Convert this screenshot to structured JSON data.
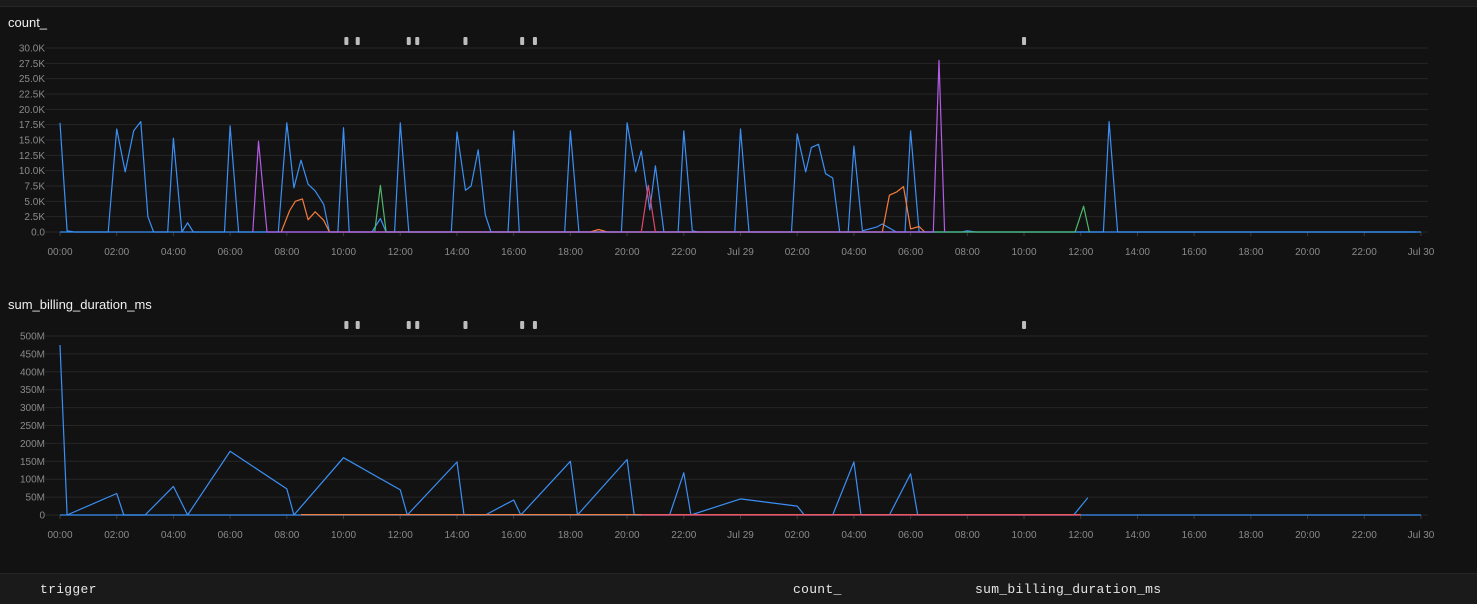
{
  "colors": {
    "blue": "#3b8ff5",
    "orange": "#f47c3c",
    "green": "#4fb86a",
    "purple": "#b55ce6",
    "pink": "#e0456e",
    "marker": "#bdbdbd",
    "grid": "#262626",
    "tick": "#8a8a8a"
  },
  "x_ticks": [
    "00:00",
    "02:00",
    "04:00",
    "06:00",
    "08:00",
    "10:00",
    "12:00",
    "14:00",
    "16:00",
    "18:00",
    "20:00",
    "22:00",
    "Jul 29",
    "02:00",
    "04:00",
    "06:00",
    "08:00",
    "10:00",
    "12:00",
    "14:00",
    "16:00",
    "18:00",
    "20:00",
    "22:00",
    "Jul 30"
  ],
  "annotation_markers_hours": [
    10.1,
    10.5,
    12.3,
    12.6,
    14.3,
    16.3,
    16.75,
    34.0
  ],
  "chart_data": [
    {
      "type": "line",
      "title": "count_",
      "x_unit": "hours since 00:00",
      "xlim": [
        0,
        48
      ],
      "ylim": [
        0,
        30000
      ],
      "y_ticks": [
        0,
        2500,
        5000,
        7500,
        10000,
        12500,
        15000,
        17500,
        20000,
        22500,
        25000,
        27500,
        30000
      ],
      "y_tick_labels": [
        "0.0",
        "2.5K",
        "5.0K",
        "7.5K",
        "10.0K",
        "12.5K",
        "15.0K",
        "17.5K",
        "20.0K",
        "22.5K",
        "25.0K",
        "27.5K",
        "30.0K"
      ],
      "series": [
        {
          "color": "blue",
          "points": [
            [
              0,
              17800
            ],
            [
              0.25,
              200
            ],
            [
              0.5,
              0
            ],
            [
              1.7,
              0
            ],
            [
              2.0,
              16800
            ],
            [
              2.3,
              9800
            ],
            [
              2.6,
              16500
            ],
            [
              2.85,
              18000
            ],
            [
              3.1,
              2500
            ],
            [
              3.3,
              0
            ],
            [
              3.8,
              0
            ],
            [
              4.0,
              15300
            ],
            [
              4.3,
              0
            ],
            [
              4.5,
              1500
            ],
            [
              4.7,
              0
            ],
            [
              5.8,
              0
            ],
            [
              6.0,
              17300
            ],
            [
              6.3,
              0
            ],
            [
              7.7,
              0
            ],
            [
              8.0,
              17800
            ],
            [
              8.25,
              7200
            ],
            [
              8.5,
              11700
            ],
            [
              8.75,
              7800
            ],
            [
              9.0,
              6700
            ],
            [
              9.3,
              4500
            ],
            [
              9.5,
              0
            ],
            [
              9.8,
              0
            ],
            [
              10.0,
              17000
            ],
            [
              10.2,
              0
            ],
            [
              11.0,
              0
            ],
            [
              11.3,
              2200
            ],
            [
              11.5,
              0
            ],
            [
              11.8,
              0
            ],
            [
              12.0,
              17800
            ],
            [
              12.3,
              0
            ],
            [
              13.8,
              0
            ],
            [
              14.0,
              16300
            ],
            [
              14.3,
              6800
            ],
            [
              14.5,
              7500
            ],
            [
              14.75,
              13400
            ],
            [
              15.0,
              2800
            ],
            [
              15.2,
              0
            ],
            [
              15.8,
              0
            ],
            [
              16.0,
              16500
            ],
            [
              16.2,
              0
            ],
            [
              17.8,
              0
            ],
            [
              18.0,
              16500
            ],
            [
              18.3,
              0
            ],
            [
              19.8,
              0
            ],
            [
              20.0,
              17800
            ],
            [
              20.3,
              9800
            ],
            [
              20.5,
              13200
            ],
            [
              20.8,
              3600
            ],
            [
              21.0,
              10800
            ],
            [
              21.3,
              0
            ],
            [
              21.8,
              0
            ],
            [
              22.0,
              16500
            ],
            [
              22.3,
              200
            ],
            [
              22.5,
              0
            ],
            [
              23.8,
              0
            ],
            [
              24.0,
              16800
            ],
            [
              24.3,
              0
            ],
            [
              25.8,
              0
            ],
            [
              26.0,
              16000
            ],
            [
              26.3,
              9800
            ],
            [
              26.5,
              13800
            ],
            [
              26.75,
              14300
            ],
            [
              27.0,
              9500
            ],
            [
              27.25,
              8800
            ],
            [
              27.5,
              0
            ],
            [
              27.8,
              0
            ],
            [
              28.0,
              14000
            ],
            [
              28.3,
              200
            ],
            [
              28.8,
              800
            ],
            [
              29.0,
              1300
            ],
            [
              29.3,
              500
            ],
            [
              29.5,
              0
            ],
            [
              29.8,
              0
            ],
            [
              30.0,
              16500
            ],
            [
              30.3,
              0
            ],
            [
              31.8,
              0
            ],
            [
              32.0,
              200
            ],
            [
              32.3,
              0
            ],
            [
              36.8,
              0
            ],
            [
              37.0,
              18000
            ],
            [
              37.3,
              0
            ],
            [
              47.8,
              0
            ]
          ]
        },
        {
          "color": "orange",
          "points": [
            [
              7.8,
              0
            ],
            [
              8.1,
              3500
            ],
            [
              8.3,
              5000
            ],
            [
              8.55,
              5400
            ],
            [
              8.75,
              2000
            ],
            [
              9.0,
              3300
            ],
            [
              9.3,
              1900
            ],
            [
              9.5,
              0
            ],
            [
              18.7,
              0
            ],
            [
              19.0,
              400
            ],
            [
              19.3,
              0
            ],
            [
              29.0,
              0
            ],
            [
              29.25,
              6000
            ],
            [
              29.5,
              6500
            ],
            [
              29.75,
              7400
            ],
            [
              30.0,
              500
            ],
            [
              30.3,
              900
            ],
            [
              30.5,
              0
            ]
          ]
        },
        {
          "color": "green",
          "points": [
            [
              11.1,
              0
            ],
            [
              11.3,
              7600
            ],
            [
              11.5,
              0
            ],
            [
              35.8,
              0
            ],
            [
              36.1,
              4200
            ],
            [
              36.3,
              0
            ]
          ]
        },
        {
          "color": "purple",
          "points": [
            [
              6.8,
              0
            ],
            [
              7.0,
              14800
            ],
            [
              7.3,
              0
            ],
            [
              30.8,
              0
            ],
            [
              31.0,
              28000
            ],
            [
              31.2,
              0
            ]
          ]
        },
        {
          "color": "pink",
          "points": [
            [
              20.5,
              0
            ],
            [
              20.75,
              7600
            ],
            [
              21.0,
              0
            ]
          ]
        }
      ]
    },
    {
      "type": "line",
      "title": "sum_billing_duration_ms",
      "x_unit": "hours since 00:00",
      "xlim": [
        0,
        48
      ],
      "ylim": [
        0,
        500000000
      ],
      "y_ticks": [
        0,
        50000000,
        100000000,
        150000000,
        200000000,
        250000000,
        300000000,
        350000000,
        400000000,
        450000000,
        500000000
      ],
      "y_tick_labels": [
        "0",
        "50M",
        "100M",
        "150M",
        "200M",
        "250M",
        "300M",
        "350M",
        "400M",
        "450M",
        "500M"
      ],
      "series": [
        {
          "color": "blue",
          "points": [
            [
              0,
              475000000
            ],
            [
              0.25,
              0
            ],
            [
              2.0,
              60000000
            ],
            [
              2.25,
              0
            ],
            [
              3.0,
              0
            ],
            [
              4.0,
              80000000
            ],
            [
              4.5,
              0
            ],
            [
              6.0,
              178000000
            ],
            [
              8.0,
              73000000
            ],
            [
              8.25,
              0
            ],
            [
              10.0,
              160000000
            ],
            [
              12.0,
              70000000
            ],
            [
              12.25,
              0
            ],
            [
              14.0,
              148000000
            ],
            [
              14.25,
              0
            ],
            [
              15.0,
              0
            ],
            [
              16.0,
              42000000
            ],
            [
              16.25,
              0
            ],
            [
              18.0,
              150000000
            ],
            [
              18.25,
              0
            ],
            [
              20.0,
              155000000
            ],
            [
              20.25,
              0
            ],
            [
              21.5,
              0
            ],
            [
              22.0,
              118000000
            ],
            [
              22.25,
              0
            ],
            [
              24.0,
              45000000
            ],
            [
              26.0,
              25000000
            ],
            [
              26.25,
              0
            ],
            [
              27.25,
              0
            ],
            [
              28.0,
              148000000
            ],
            [
              28.25,
              0
            ],
            [
              29.25,
              0
            ],
            [
              30.0,
              115000000
            ],
            [
              30.25,
              0
            ],
            [
              35.75,
              0
            ],
            [
              36.25,
              48000000
            ]
          ]
        },
        {
          "color": "orange",
          "points": [
            [
              8.5,
              1000000
            ],
            [
              36.0,
              1000000
            ]
          ]
        },
        {
          "color": "pink",
          "points": [
            [
              20.5,
              0
            ],
            [
              36.0,
              0
            ]
          ]
        }
      ]
    }
  ],
  "table": {
    "headers": [
      "trigger",
      "count_",
      "sum_billing_duration_ms"
    ]
  }
}
